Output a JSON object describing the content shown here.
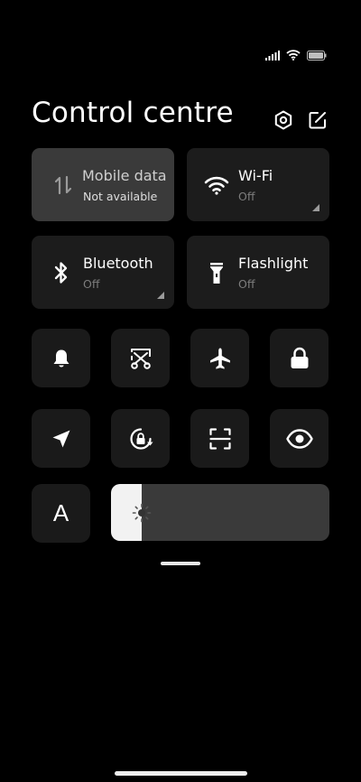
{
  "status_bar": {
    "icons": [
      "signal-icon",
      "wifi-icon",
      "battery-icon"
    ]
  },
  "header": {
    "title": "Control centre",
    "icons": [
      "settings-icon",
      "edit-icon"
    ]
  },
  "big_tiles": [
    {
      "id": "mobile-data",
      "label": "Mobile data",
      "status": "Not available",
      "icon": "data-transfer-icon",
      "disabled": true
    },
    {
      "id": "wifi",
      "label": "Wi-Fi",
      "status": "Off",
      "icon": "wifi-icon",
      "expandable": true
    },
    {
      "id": "bluetooth",
      "label": "Bluetooth",
      "status": "Off",
      "icon": "bluetooth-icon",
      "expandable": true
    },
    {
      "id": "flashlight",
      "label": "Flashlight",
      "status": "Off",
      "icon": "flashlight-icon"
    }
  ],
  "small_tiles": [
    {
      "id": "silent",
      "icon": "bell-icon"
    },
    {
      "id": "screenshot",
      "icon": "scissors-icon"
    },
    {
      "id": "airplane",
      "icon": "airplane-icon"
    },
    {
      "id": "lock-screen",
      "icon": "lock-icon"
    },
    {
      "id": "location",
      "icon": "location-arrow-icon"
    },
    {
      "id": "rotation-lock",
      "icon": "rotation-lock-icon"
    },
    {
      "id": "scanner",
      "icon": "scan-icon"
    },
    {
      "id": "reading-mode",
      "icon": "eye-icon"
    }
  ],
  "font_button": {
    "label": "A",
    "icon": "font-size-icon"
  },
  "brightness": {
    "level": 0.14,
    "icon": "sun-icon",
    "fill_color": "#f2f2f2",
    "track_color": "#3a3a3a"
  }
}
